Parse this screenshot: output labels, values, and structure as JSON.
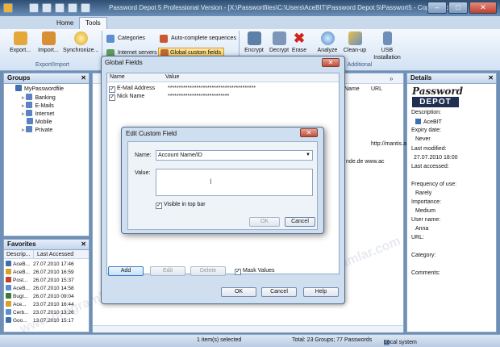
{
  "window": {
    "title": "Password Depot 5 Professional Version - [X:\\Passwortfiles\\C:\\Users\\AceBIT\\Password Depot 5\\Passwort5 - Copyer Mode]"
  },
  "tabs": [
    {
      "label": "Home"
    },
    {
      "label": "Tools"
    }
  ],
  "ribbon": {
    "export": "Export...",
    "import": "Import...",
    "sync": "Synchronize...",
    "group_export_import": "Export/Import",
    "categories": "Categories",
    "internet_servers": "Internet servers",
    "auto_complete": "Auto-complete sequences",
    "global_custom_fields": "Global custom fields",
    "encrypt": "Encrypt",
    "decrypt": "Decrypt",
    "erase": "Erase",
    "analyze": "Analyze",
    "cleanup": "Clean-up",
    "usb": "USB Installation",
    "group_additional": "Additional"
  },
  "groups": {
    "title": "Groups",
    "root": "MyPasswordfile",
    "items": [
      "Banking",
      "E-Mails",
      "Internet",
      "Mobile",
      "Private"
    ]
  },
  "favorites": {
    "title": "Favorites",
    "col_desc": "Descrip...",
    "col_last": "Last Accessed",
    "rows": [
      {
        "name": "AceB...",
        "date": "27.07.2010 17:46"
      },
      {
        "name": "AceB...",
        "date": "26.07.2010 16:59"
      },
      {
        "name": "Post...",
        "date": "26.07.2010 15:37"
      },
      {
        "name": "AceB...",
        "date": "26.07.2010 14:58"
      },
      {
        "name": "Bugt...",
        "date": "26.07.2010 09:04"
      },
      {
        "name": "Ace...",
        "date": "23.07.2010 16:44"
      },
      {
        "name": "Cerb...",
        "date": "23.07.2010 13:26"
      },
      {
        "name": "Goo...",
        "date": "13.07.2010 15:17"
      }
    ]
  },
  "main": {
    "col_name": "Name",
    "col_url": "URL",
    "url1": "http://mantis.a",
    "url2": "nde.de   www.ac"
  },
  "details": {
    "title": "Details",
    "logo_top": "Password",
    "logo_bottom": "DEPOT",
    "description_label": "Description:",
    "description": "AceBIT",
    "expiry_label": "Expiry date:",
    "expiry": "Never",
    "modified_label": "Last modified:",
    "modified": "27.07.2010 18:00",
    "accessed_label": "Last accessed:",
    "frequency_label": "Frequency of use:",
    "frequency": "Rarely",
    "importance_label": "Importance:",
    "importance": "Medium",
    "username_label": "User name:",
    "username": "Anna",
    "url_label": "URL:",
    "category_label": "Category:",
    "comments_label": "Comments:"
  },
  "global_fields": {
    "title": "Global Fields",
    "col_name": "Name",
    "col_value": "Value",
    "rows": [
      {
        "name": "E-Mail Address",
        "value": "****************************************"
      },
      {
        "name": "Nick Name",
        "value": "****************************"
      }
    ],
    "add": "Add",
    "edit": "Edit",
    "delete": "Delete",
    "mask_values": "Mask Values",
    "ok": "OK",
    "cancel": "Cancel",
    "help": "Help"
  },
  "edit_field": {
    "title": "Edit Custom Field",
    "name_label": "Name:",
    "name_value": "Account Name/ID",
    "value_label": "Value:",
    "value_text": "",
    "visible_top_bar": "Visible in top bar",
    "ok": "OK",
    "cancel": "Cancel"
  },
  "status": {
    "selected": "1 item(s) selected",
    "total": "Total: 23 Groups; 77 Passwords",
    "location": "Local system"
  },
  "watermark": "www.programlar.com"
}
